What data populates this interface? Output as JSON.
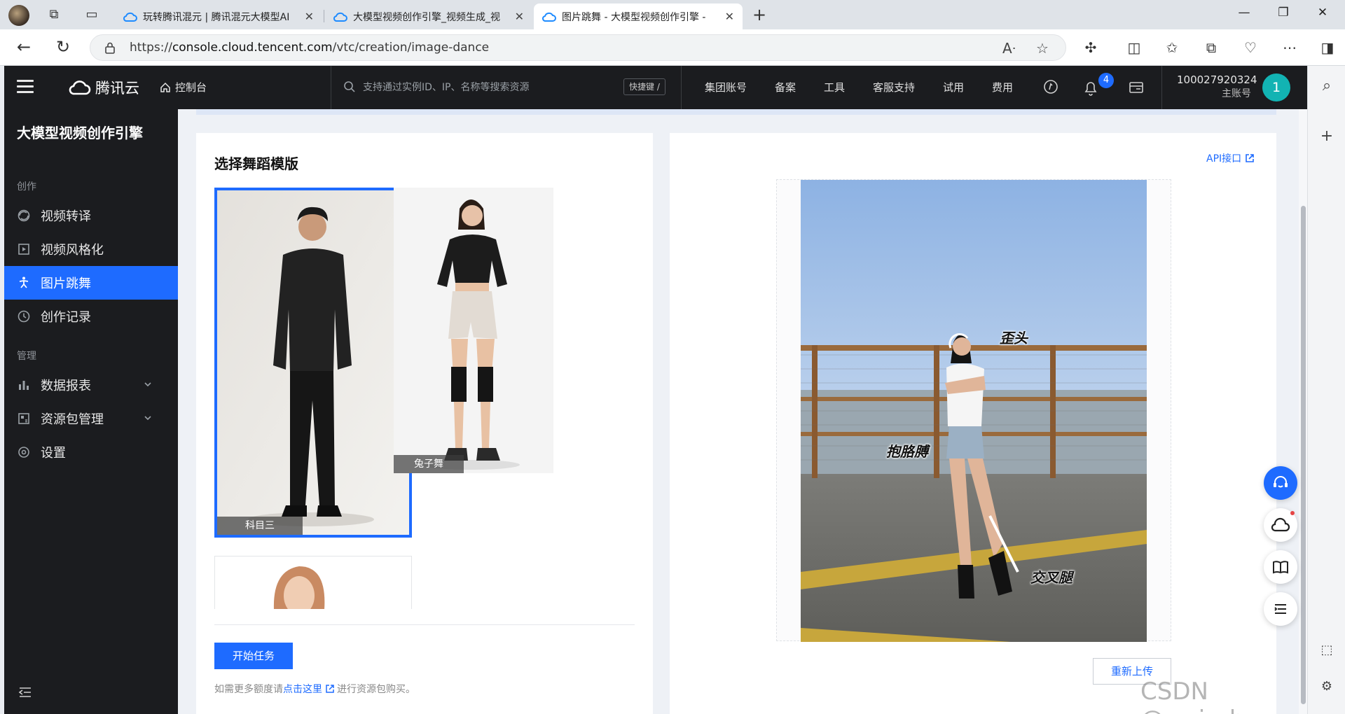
{
  "browser": {
    "tabs": [
      {
        "title": "玩转腾讯混元 | 腾讯混元大模型AI",
        "active": false
      },
      {
        "title": "大模型视频创作引擎_视频生成_视",
        "active": false
      },
      {
        "title": "图片跳舞 - 大模型视频创作引擎 -",
        "active": true
      }
    ],
    "url_prefix": "https://",
    "url_domain": "console.cloud.tencent.com",
    "url_path": "/vtc/creation/image-dance"
  },
  "topbar": {
    "brand": "腾讯云",
    "console": "控制台",
    "search_placeholder": "支持通过实例ID、IP、名称等搜索资源",
    "shortcut": "快捷键 /",
    "nav": [
      "集团账号",
      "备案",
      "工具",
      "客服支持",
      "试用",
      "费用"
    ],
    "notification_count": "4",
    "account_id": "100027920324",
    "account_role": "主账号",
    "avatar_letter": "1"
  },
  "sidebar": {
    "title": "大模型视频创作引擎",
    "sections": [
      {
        "label": "创作",
        "items": [
          {
            "label": "视频转译",
            "icon": "video-translate-icon"
          },
          {
            "label": "视频风格化",
            "icon": "video-style-icon"
          },
          {
            "label": "图片跳舞",
            "icon": "dance-icon",
            "active": true
          },
          {
            "label": "创作记录",
            "icon": "history-icon"
          }
        ]
      },
      {
        "label": "管理",
        "items": [
          {
            "label": "数据报表",
            "icon": "bar-chart-icon",
            "expandable": true
          },
          {
            "label": "资源包管理",
            "icon": "package-icon",
            "expandable": true
          },
          {
            "label": "设置",
            "icon": "settings-icon"
          }
        ]
      }
    ]
  },
  "main": {
    "section_title": "选择舞蹈模版",
    "templates": [
      {
        "name": "科目三",
        "selected": true
      },
      {
        "name": "兔子舞",
        "selected": false
      }
    ],
    "start_button": "开始任务",
    "note_prefix": "如需更多额度请",
    "note_link": "点击这里",
    "note_suffix": "进行资源包购买。",
    "api_link": "API接口",
    "annotations": [
      "歪头",
      "抱胳膊",
      "交叉腿"
    ],
    "reupload_button": "重新上传"
  },
  "watermark": "CSDN @wei_shuo",
  "colors": {
    "accent": "#1e6bff",
    "console_dark": "#1b1c1f",
    "avatar": "#12b3b3"
  }
}
